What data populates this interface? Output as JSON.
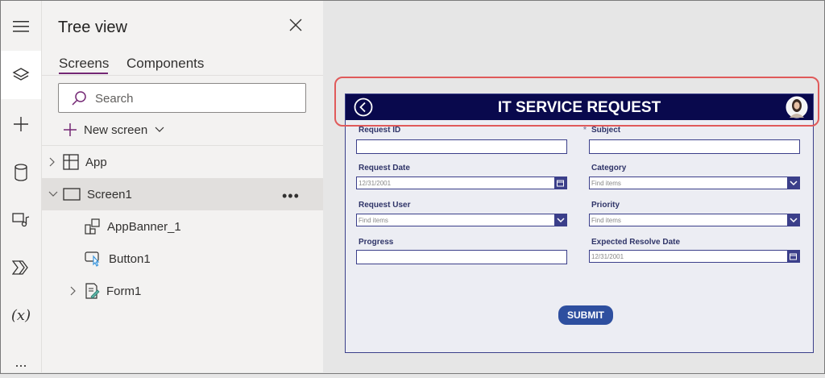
{
  "panel": {
    "title": "Tree view",
    "tabs": [
      {
        "label": "Screens"
      },
      {
        "label": "Components"
      }
    ],
    "search_placeholder": "Search",
    "new_screen_label": "New screen",
    "tree": [
      {
        "label": "App"
      },
      {
        "label": "Screen1"
      },
      {
        "label": "AppBanner_1"
      },
      {
        "label": "Button1"
      },
      {
        "label": "Form1"
      }
    ]
  },
  "rail": {
    "variable_label": "(x)",
    "more_label": "..."
  },
  "app": {
    "title": "IT SERVICE REQUEST",
    "fields": [
      {
        "label": "Request ID",
        "value": ""
      },
      {
        "label": "Subject",
        "value": ""
      },
      {
        "label": "Request Date",
        "value": "12/31/2001"
      },
      {
        "label": "Category",
        "value": "Find items"
      },
      {
        "label": "Request User",
        "value": "Find items"
      },
      {
        "label": "Priority",
        "value": "Find items"
      },
      {
        "label": "Progress",
        "value": ""
      },
      {
        "label": "Expected Resolve Date",
        "value": "12/31/2001"
      }
    ],
    "required_mark": "*",
    "submit_label": "SUBMIT"
  },
  "colors": {
    "banner": "#09094d",
    "accent": "#742774",
    "highlight": "#e05a5a",
    "submit": "#2e4f9f"
  }
}
